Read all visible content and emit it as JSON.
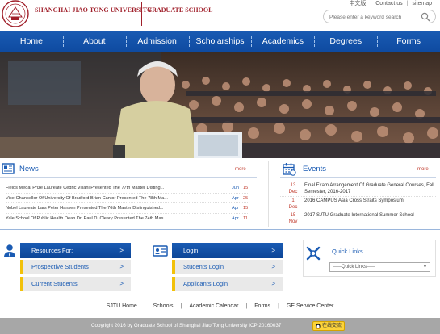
{
  "header": {
    "university": "SHANGHAI JIAO TONG UNIVERSITY",
    "school": "GRADUATE SCHOOL",
    "toplinks": [
      "中文版",
      "Contact us",
      "sitemap"
    ],
    "search_placeholder": "Please enter a keyword search"
  },
  "nav": [
    "Home",
    "About",
    "Admission",
    "Scholarships",
    "Academics",
    "Degrees",
    "Forms"
  ],
  "news": {
    "title": "News",
    "more": "more",
    "items": [
      {
        "text": "Fields Medal Prize Laureate Cédric Villani Presented The 77th Master Disting...",
        "month": "Jun",
        "day": "15"
      },
      {
        "text": "Vice-Chancellor Of University Of Bradford Brian Cantor Presented The 78th Ma...",
        "month": "Apr",
        "day": "25"
      },
      {
        "text": "Nobel Laureate Lars Peter Hansen Presented The 76th Master Distinguished...",
        "month": "Apr",
        "day": "15"
      },
      {
        "text": "Yale School Of Public Health Dean Dr. Paul D. Cleary Presented The 74th Mas...",
        "month": "Apr",
        "day": "11"
      }
    ]
  },
  "events": {
    "title": "Events",
    "more": "more",
    "items": [
      {
        "day": "13",
        "month": "Dec",
        "text": "Final Exam Arrangement Of Graduate General Courses, Fall Semester, 2016-2017"
      },
      {
        "day": "1",
        "month": "Dec",
        "text": "2016 CAMPUS Asia Cross Straits Symposium"
      },
      {
        "day": "15",
        "month": "Nov",
        "text": "2017 SJTU Graduate International Summer School"
      }
    ]
  },
  "resources": {
    "head": "Resources For:",
    "items": [
      "Prospective Students",
      "Current Students"
    ]
  },
  "login": {
    "head": "Login:",
    "items": [
      "Students Login",
      "Applicants Login"
    ]
  },
  "quick_links": {
    "title": "Quick Links",
    "selected": "-----Quick Links-----"
  },
  "chevron": ">",
  "footer": {
    "links": [
      "SJTU Home",
      "Schools",
      "Academic Calendar",
      "Forms",
      "GE Service Center"
    ],
    "copyright": "Copyright 2016 by Graduate School of Shanghai Jiao Tong University ICP 20160037",
    "chat_label": "在线交流"
  },
  "colors": {
    "brand_blue": "#1a5bb3",
    "brand_red": "#a01f2a",
    "accent_yellow": "#f2c10a"
  }
}
